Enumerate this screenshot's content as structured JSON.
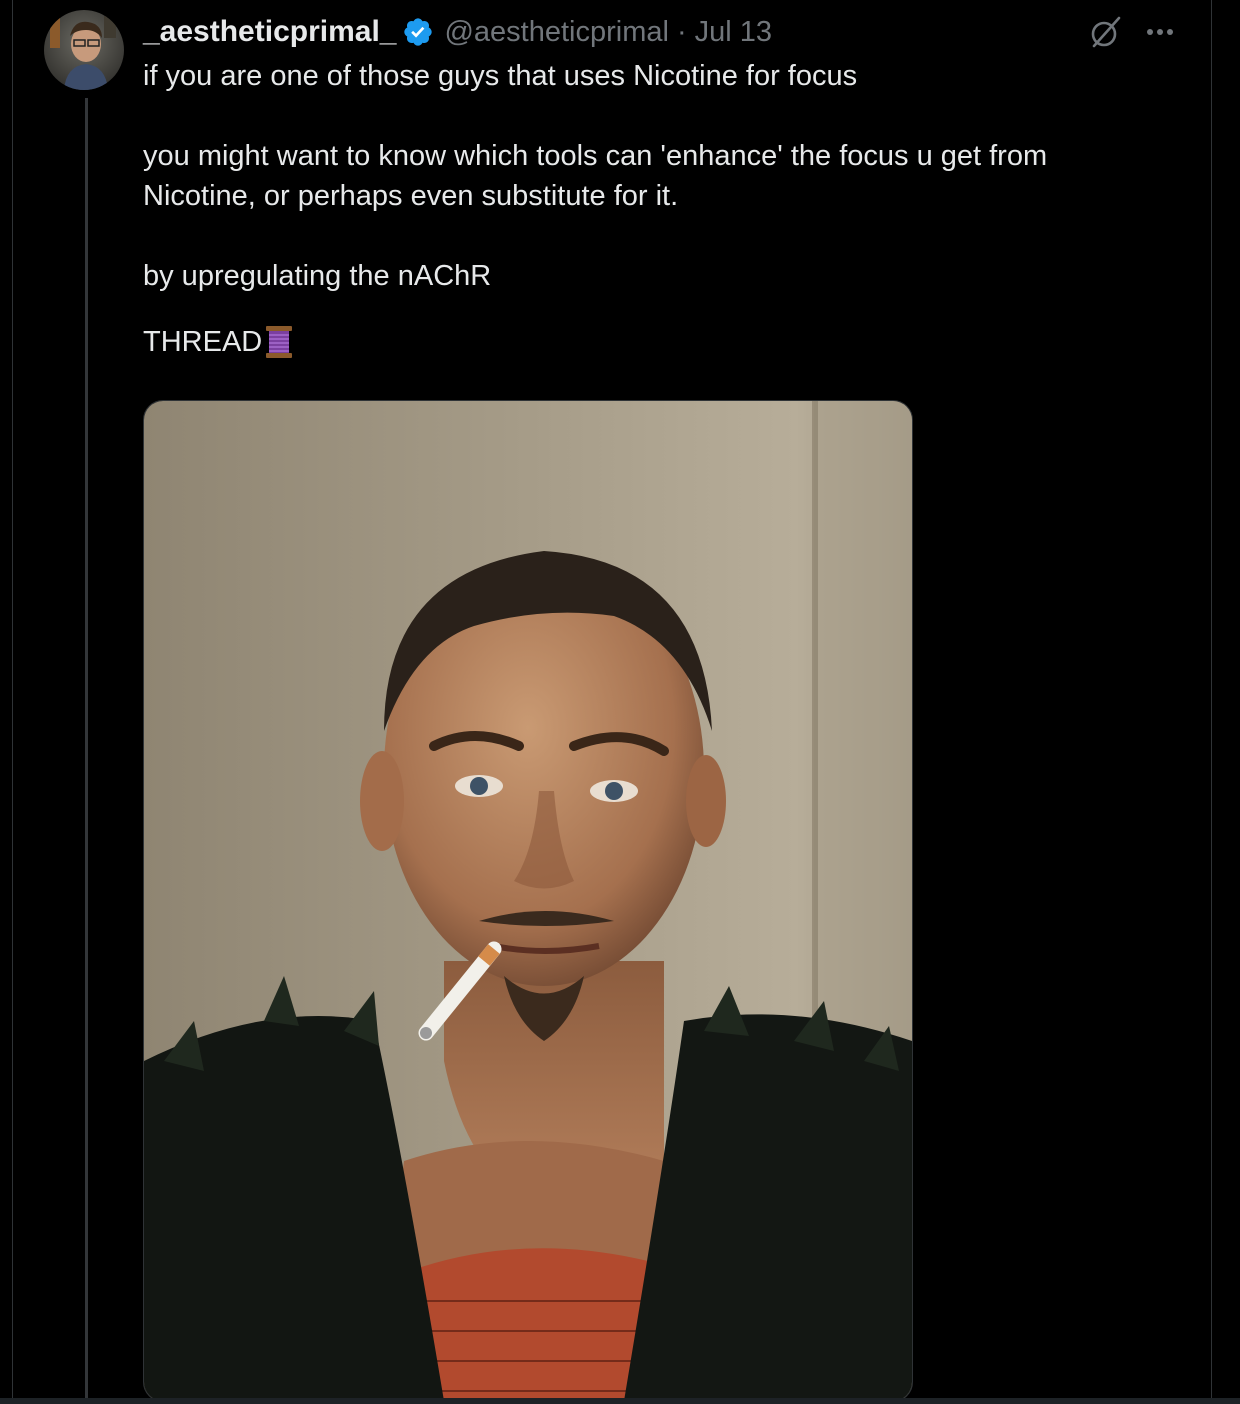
{
  "tweet": {
    "display_name": "_aestheticprimal_",
    "handle": "@aestheticprimal",
    "separator": "·",
    "date": "Jul 13",
    "verified": true,
    "paragraphs": [
      "if you are one of those guys that uses Nicotine for focus",
      "you might want to know which tools can 'enhance' the focus u get from Nicotine, or perhaps even substitute for it.",
      "by upregulating the nAChR",
      "THREAD"
    ],
    "thread_emoji": "spool-of-thread-icon"
  },
  "icons": {
    "verified": "verified-badge-icon",
    "grok": "grok-icon",
    "more": "more-options-icon"
  },
  "colors": {
    "background": "#000000",
    "text_primary": "#e7e9ea",
    "text_secondary": "#71767b",
    "verified_blue": "#1d9bf0",
    "border": "#2f3336"
  },
  "media": {
    "type": "photo",
    "subject": "portrait-with-cigarette"
  }
}
